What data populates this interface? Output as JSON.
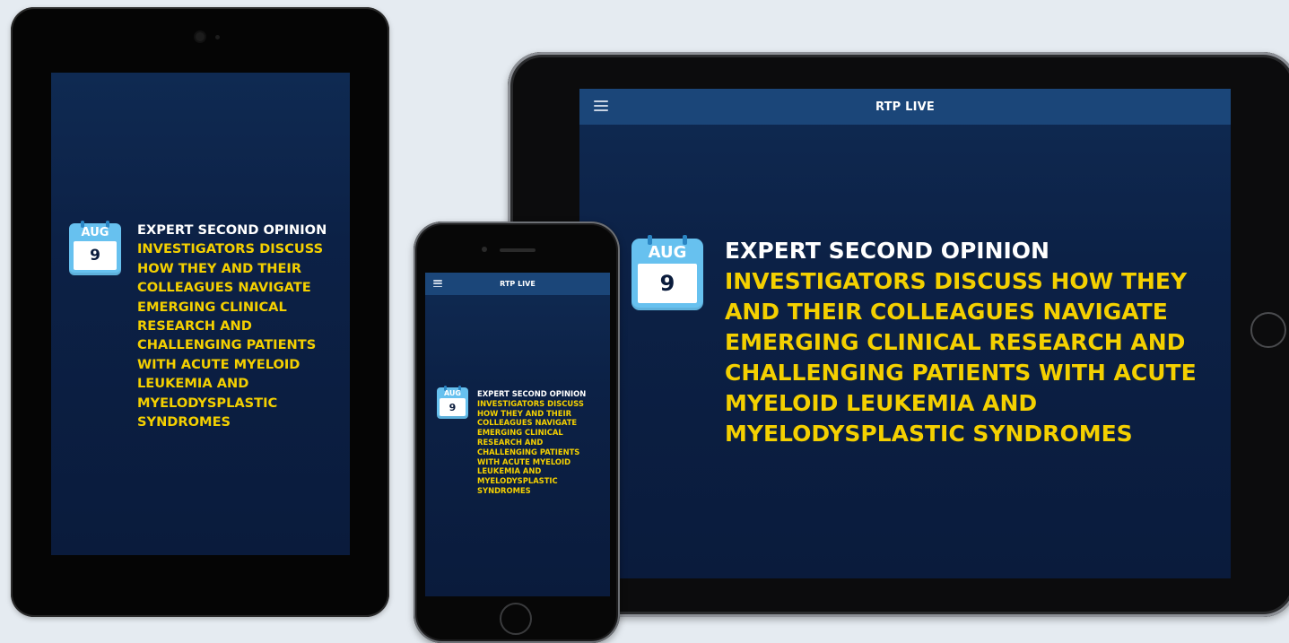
{
  "app": {
    "title": "RTP LIVE"
  },
  "event": {
    "month": "AUG",
    "day": "9",
    "heading": "EXPERT SECOND OPINION",
    "description": "INVESTIGATORS DISCUSS HOW THEY AND THEIR COLLEAGUES NAVIGATE EMERGING CLINICAL RESEARCH AND CHALLENGING PATIENTS WITH ACUTE MYELOID LEUKEMIA AND MYELODYSPLASTIC SYNDROMES"
  },
  "colors": {
    "background": "#e5ebf1",
    "screen": "#0c2146",
    "appbar": "#1b4679",
    "accent_yellow": "#f4d000",
    "calendar_blue": "#67c1ef"
  },
  "icons": {
    "menu": "hamburger-menu-icon",
    "calendar": "calendar-icon",
    "home": "home-button"
  }
}
